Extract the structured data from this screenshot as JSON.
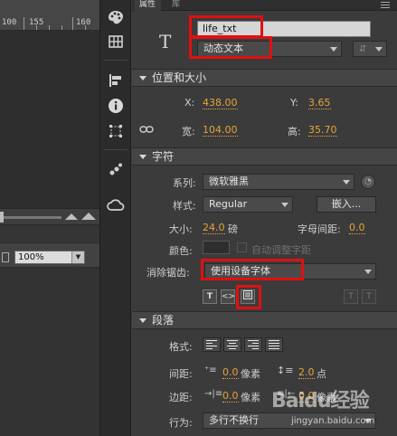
{
  "stage": {
    "ruler_labels": [
      "100",
      "155",
      "160"
    ],
    "zoom_value": "100%"
  },
  "panel": {
    "tabs": [
      "属性",
      "库"
    ],
    "instance_name": "life_txt",
    "text_type": "动态文本",
    "position_size": {
      "title": "位置和大小",
      "x_label": "X:",
      "x_value": "438.00",
      "y_label": "Y:",
      "y_value": "3.65",
      "w_label": "宽:",
      "w_value": "104.00",
      "h_label": "高:",
      "h_value": "35.70"
    },
    "character": {
      "title": "字符",
      "family_label": "系列:",
      "family_value": "微软雅黑",
      "style_label": "样式:",
      "style_value": "Regular",
      "embed_label": "嵌入...",
      "size_label": "大小:",
      "size_value": "24.0",
      "size_unit": "磅",
      "spacing_label": "字母间距:",
      "spacing_value": "0.0",
      "color_label": "颜色:",
      "auto_kern_label": "自动调整字距",
      "antialias_label": "消除锯齿:",
      "antialias_value": "使用设备字体"
    },
    "paragraph": {
      "title": "段落",
      "format_label": "格式:",
      "spacing_label": "间距:",
      "indent_value": "0.0",
      "indent_unit": "像素",
      "line_spacing_value": "2.0",
      "line_spacing_unit": "点",
      "margin_label": "边距:",
      "left_margin_value": "0.0",
      "left_margin_unit": "像素",
      "right_margin_value": "0.0",
      "right_margin_unit": "像素",
      "behavior_label": "行为:",
      "behavior_value": "多行不换行"
    }
  },
  "watermark": {
    "brand": "Baidu经验",
    "url": "jingyan.baidu.com"
  },
  "colors": {
    "accent_value": "#e8a33a",
    "highlight": "#e01010",
    "panel_bg": "#3b3b3b"
  }
}
